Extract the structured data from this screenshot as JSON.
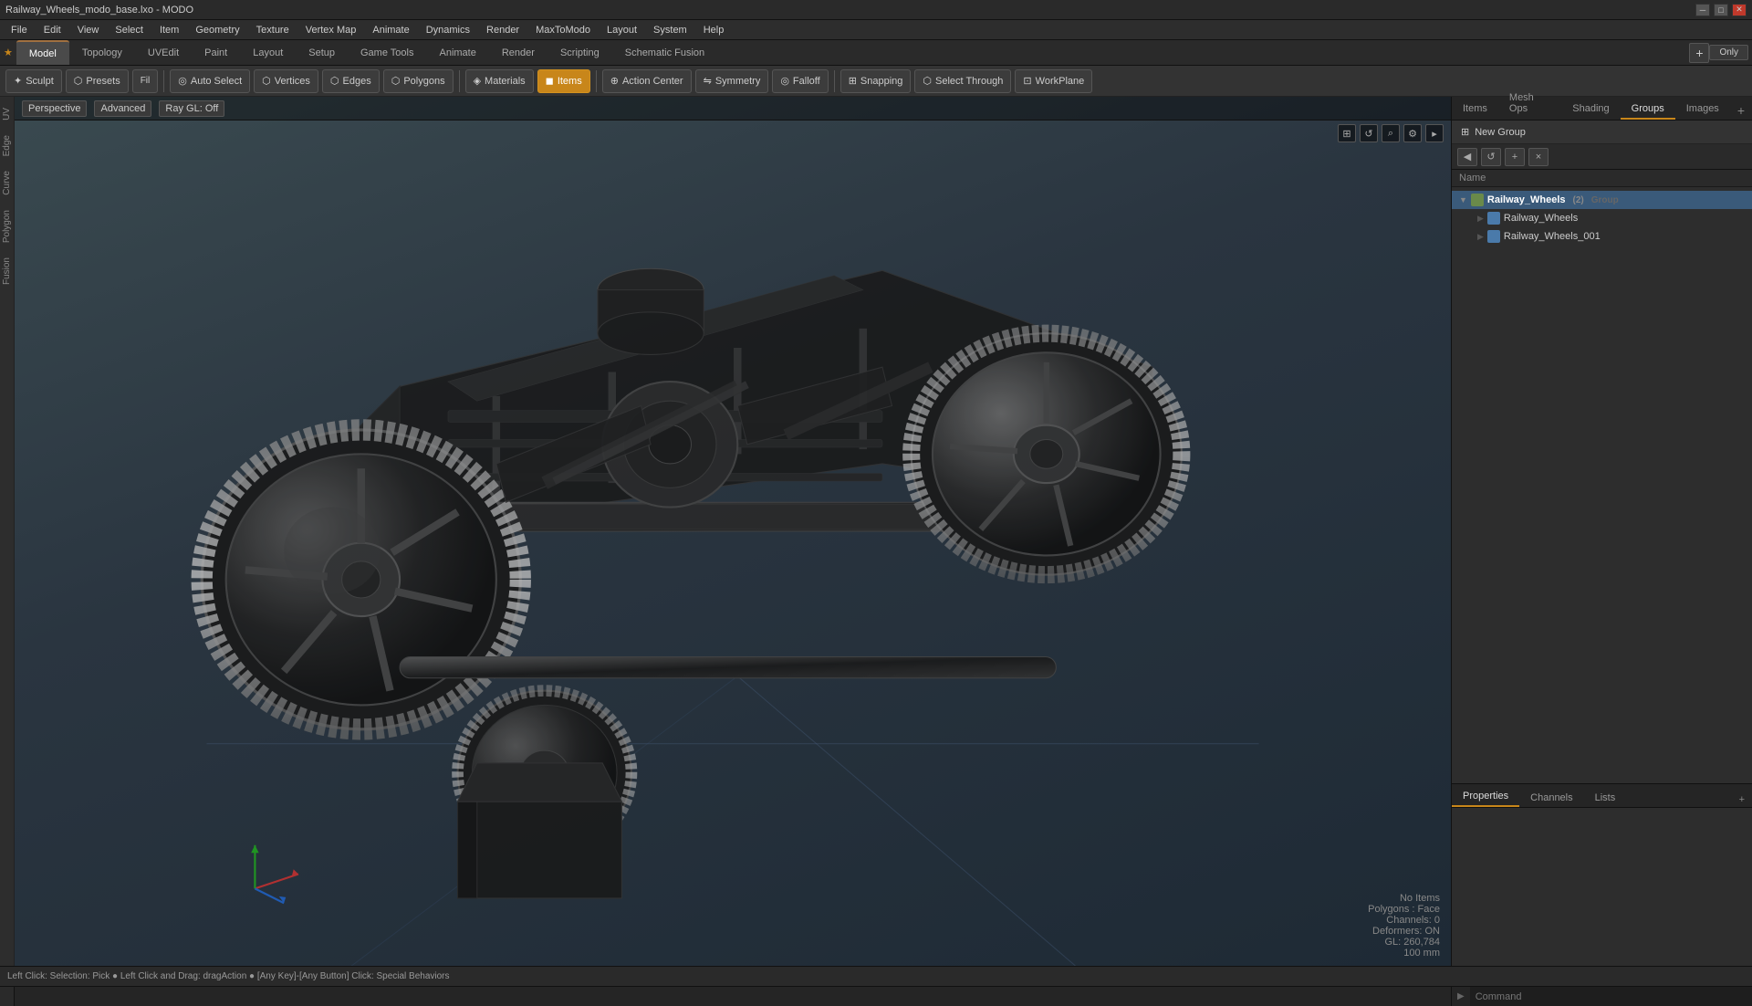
{
  "window": {
    "title": "Railway_Wheels_modo_base.lxo - MODO"
  },
  "titlebar": {
    "minimize": "─",
    "maximize": "□",
    "close": "✕"
  },
  "menubar": {
    "items": [
      "File",
      "Edit",
      "View",
      "Select",
      "Item",
      "Geometry",
      "Texture",
      "Vertex Map",
      "Animate",
      "Dynamics",
      "Render",
      "MaxToModo",
      "Layout",
      "System",
      "Help"
    ]
  },
  "top_tabs": {
    "items": [
      "Model",
      "Topology",
      "UVEdit",
      "Paint",
      "Layout",
      "Setup",
      "Game Tools",
      "Animate",
      "Render",
      "Scripting",
      "Schematic Fusion"
    ],
    "active": "Model",
    "plus_label": "+",
    "only_label": "Only",
    "star_label": "★"
  },
  "toolbar": {
    "sculpt_label": "Sculpt",
    "presets_label": "Presets",
    "fill_label": "Fill",
    "auto_select_label": "Auto Select",
    "vertices_label": "Vertices",
    "edges_label": "Edges",
    "polygons_label": "Polygons",
    "materials_label": "Materials",
    "items_label": "Items",
    "action_center_label": "Action Center",
    "symmetry_label": "Symmetry",
    "falloff_label": "Falloff",
    "snapping_label": "Snapping",
    "select_through_label": "Select Through",
    "workplane_label": "WorkPlane"
  },
  "viewport": {
    "perspective_label": "Perspective",
    "advanced_label": "Advanced",
    "ray_gl_label": "Ray GL: Off"
  },
  "viewport_info": {
    "no_items": "No Items",
    "polygons": "Polygons : Face",
    "channels": "Channels: 0",
    "deformers": "Deformers: ON",
    "gl_coords": "GL: 260,784",
    "scale": "100 mm"
  },
  "status_bar": {
    "text": "Left Click: Selection: Pick  ●  Left Click and Drag: dragAction  ●  [Any Key]-[Any Button] Click: Special Behaviors",
    "dot1": true,
    "dot2": true
  },
  "right_panel": {
    "tabs": [
      "Items",
      "Mesh Ops",
      "Shading",
      "Groups",
      "Images"
    ],
    "active_tab": "Groups",
    "plus_label": "+"
  },
  "groups": {
    "new_group_btn": "New Group",
    "name_header": "Name",
    "tree": [
      {
        "id": "root",
        "label": "Railway_Wheels",
        "count": "(2)",
        "type_label": "Group",
        "type": "group",
        "level": 0,
        "expanded": true,
        "selected": true
      },
      {
        "id": "child1",
        "label": "Railway_Wheels",
        "type": "mesh",
        "level": 1,
        "expanded": false,
        "selected": false
      },
      {
        "id": "child2",
        "label": "Railway_Wheels_001",
        "type": "mesh",
        "level": 1,
        "expanded": false,
        "selected": false
      }
    ]
  },
  "properties": {
    "tabs": [
      "Properties",
      "Channels",
      "Lists"
    ],
    "active_tab": "Properties",
    "plus_label": "+"
  },
  "command_bar": {
    "placeholder": "Command",
    "label": ""
  },
  "left_vtabs": [
    "UV",
    "Edge",
    "Curve",
    "Polygon",
    "Fusion"
  ]
}
